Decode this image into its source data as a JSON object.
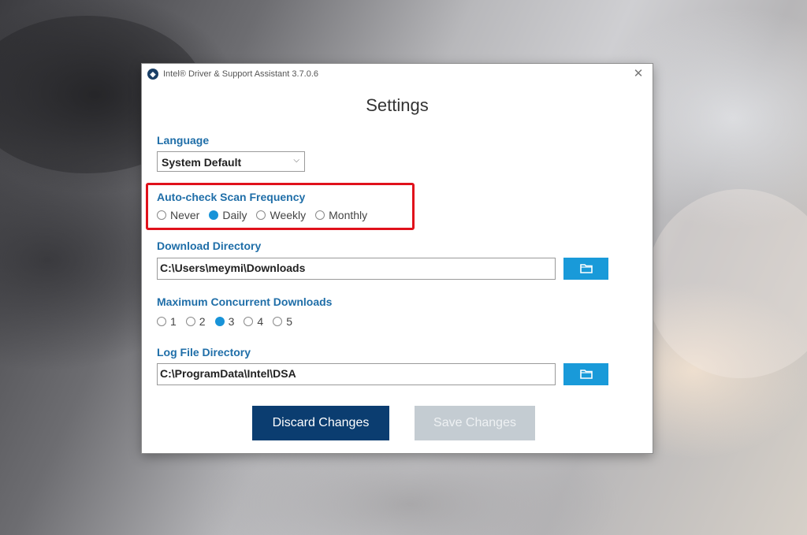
{
  "window": {
    "title": "Intel® Driver & Support Assistant 3.7.0.6",
    "close_glyph": "✕",
    "app_icon": "intel-dsa-icon"
  },
  "heading": "Settings",
  "language": {
    "label": "Language",
    "selected": "System Default"
  },
  "scan_frequency": {
    "label": "Auto-check Scan Frequency",
    "options": [
      "Never",
      "Daily",
      "Weekly",
      "Monthly"
    ],
    "selected": "Daily"
  },
  "download_directory": {
    "label": "Download Directory",
    "value": "C:\\Users\\meymi\\Downloads"
  },
  "max_downloads": {
    "label": "Maximum Concurrent Downloads",
    "options": [
      "1",
      "2",
      "3",
      "4",
      "5"
    ],
    "selected": "3"
  },
  "log_directory": {
    "label": "Log File Directory",
    "value": "C:\\ProgramData\\Intel\\DSA"
  },
  "buttons": {
    "discard": "Discard Changes",
    "save": "Save Changes"
  },
  "colors": {
    "accent": "#199ad9",
    "label_blue": "#1f6ea8",
    "primary_button": "#0b3d70",
    "disabled_button": "#c4ccd2",
    "highlight_box": "#e0111b"
  }
}
